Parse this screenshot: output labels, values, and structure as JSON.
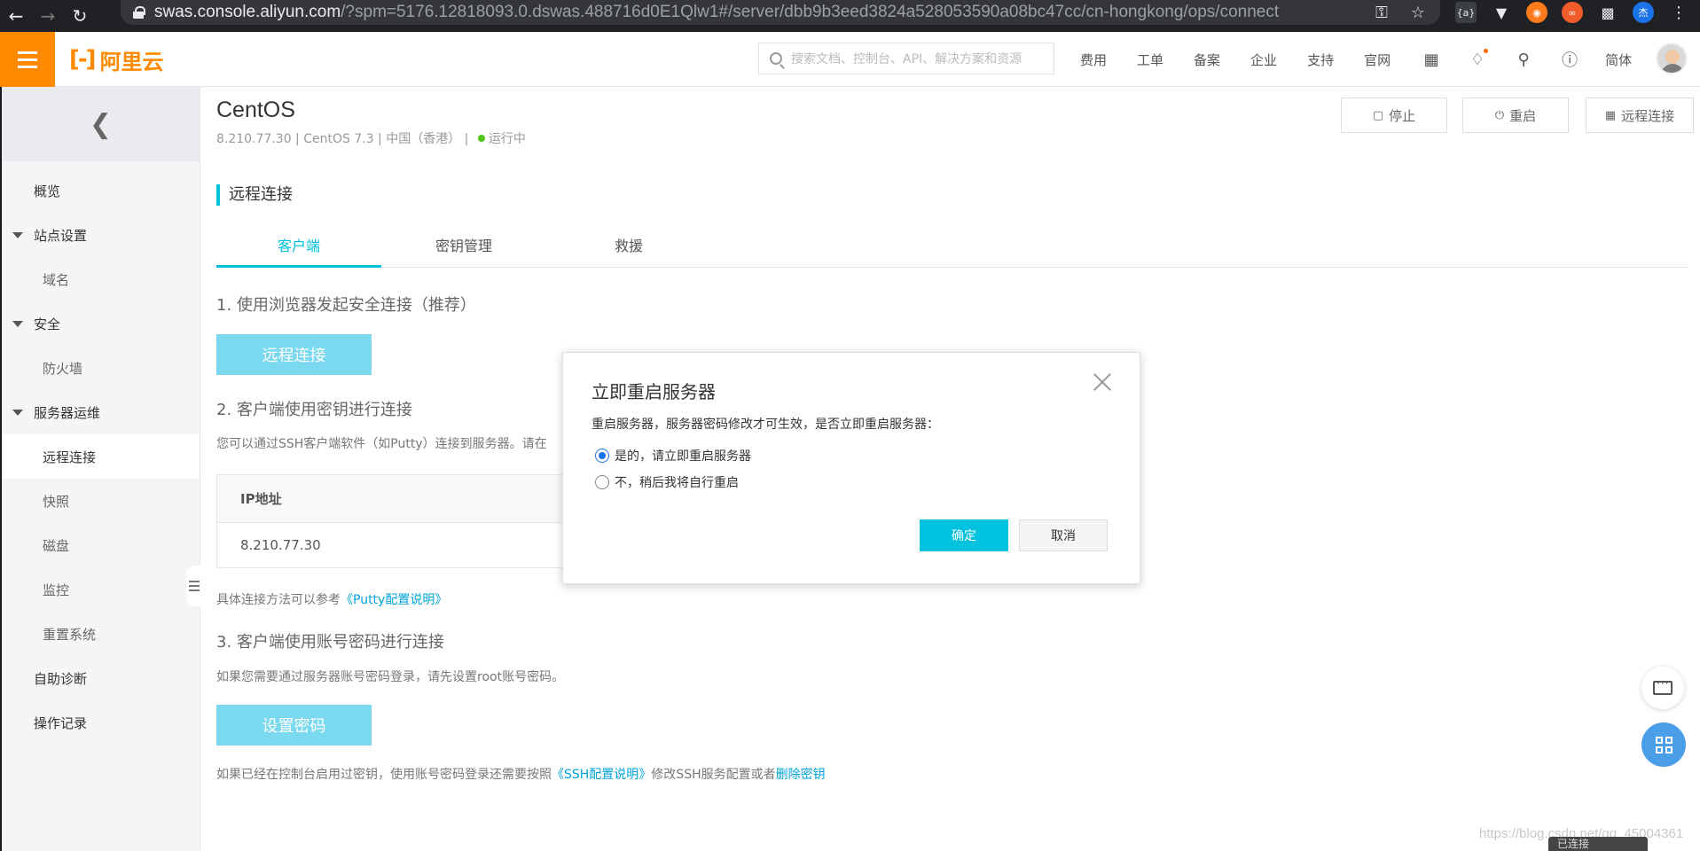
{
  "browser": {
    "url_domain": "swas.console.aliyun.com",
    "url_path": "/?spm=5176.12818093.0.dswas.488716d0E1Qlw1#/server/dbb9b3eed3824a528053590a08bc47cc/cn-hongkong/ops/connect",
    "ext_badge": "杰"
  },
  "header": {
    "brand": "阿里云",
    "search_placeholder": "搜索文档、控制台、API、解决方案和资源",
    "nav": [
      "费用",
      "工单",
      "备案",
      "企业",
      "支持",
      "官网"
    ],
    "lang": "简体"
  },
  "sidebar": {
    "items": [
      {
        "label": "概览"
      },
      {
        "label": "站点设置"
      },
      {
        "label": "域名"
      },
      {
        "label": "安全"
      },
      {
        "label": "防火墙"
      },
      {
        "label": "服务器运维"
      },
      {
        "label": "远程连接"
      },
      {
        "label": "快照"
      },
      {
        "label": "磁盘"
      },
      {
        "label": "监控"
      },
      {
        "label": "重置系统"
      },
      {
        "label": "自助诊断"
      },
      {
        "label": "操作记录"
      }
    ]
  },
  "instance": {
    "name": "CentOS",
    "ip": "8.210.77.30",
    "os": "CentOS 7.3",
    "region": "中国（香港）",
    "status": "运行中",
    "actions": {
      "stop": "停止",
      "restart": "重启",
      "connect": "远程连接"
    }
  },
  "main": {
    "section_title": "远程连接",
    "tabs": [
      "客户端",
      "密钥管理",
      "救援"
    ],
    "step1": "1. 使用浏览器发起安全连接（推荐）",
    "step1_button": "远程连接",
    "step2": "2. 客户端使用密钥进行连接",
    "step2_note": "您可以通过SSH客户端软件（如Putty）连接到服务器。请在",
    "ip_header": "IP地址",
    "ip_value": "8.210.77.30",
    "putty_prefix": "具体连接方法可以参考",
    "putty_link": "《Putty配置说明》",
    "step3": "3. 客户端使用账号密码进行连接",
    "step3_note": "如果您需要通过服务器账号密码登录，请先设置root账号密码。",
    "step3_button": "设置密码",
    "ssh_prefix": "如果已经在控制台启用过密钥，使用账号密码登录还需要按照",
    "ssh_link": "《SSH配置说明》",
    "ssh_middle": "修改SSH服务配置或者",
    "ssh_link2": "删除密钥"
  },
  "modal": {
    "title": "立即重启服务器",
    "description": "重启服务器，服务器密码修改才可生效，是否立即重启服务器：",
    "option_yes": "是的，请立即重启服务器",
    "option_no": "不，稍后我将自行重启",
    "ok": "确定",
    "cancel": "取消"
  },
  "footer": {
    "watermark": "https://blog.csdn.net/qq_45004361",
    "connected": "已连接"
  }
}
